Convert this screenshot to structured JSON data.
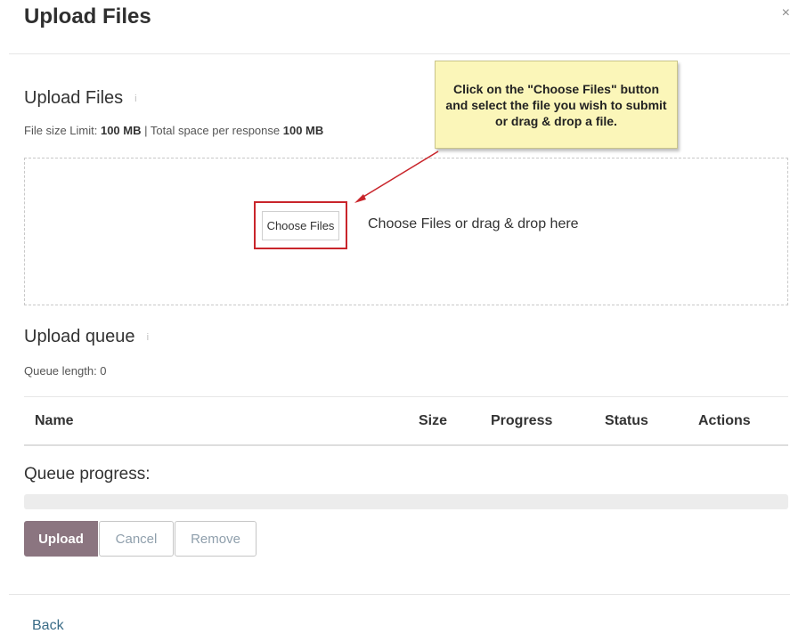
{
  "modal": {
    "title": "Upload Files",
    "close_label": "×"
  },
  "upload_section": {
    "title": "Upload Files",
    "info_icon": "i",
    "limit_prefix": "File size Limit: ",
    "limit_value": "100 MB",
    "space_prefix": " | Total space per response ",
    "space_value": "100 MB"
  },
  "dropzone": {
    "button_label": "Choose Files",
    "hint": "Choose Files or drag & drop here"
  },
  "callout": {
    "text": "Click on the \"Choose Files\" button and select the file you wish to submit or drag & drop a file."
  },
  "queue": {
    "title": "Upload queue",
    "info_icon": "i",
    "length_text": "Queue length: 0",
    "columns": [
      "Name",
      "Size",
      "Progress",
      "Status",
      "Actions"
    ]
  },
  "queue_progress": {
    "label": "Queue progress:",
    "value_percent": 0
  },
  "actions": {
    "upload": "Upload",
    "cancel": "Cancel",
    "remove": "Remove"
  },
  "footer": {
    "back": "Back"
  },
  "colors": {
    "primary": "#8b7580",
    "highlight_border": "#c9252b",
    "callout_bg": "#fbf6b9",
    "link": "#3a6c87"
  },
  "icons": {
    "close": "close-icon",
    "info": "info-icon",
    "arrow": "arrow-icon"
  }
}
